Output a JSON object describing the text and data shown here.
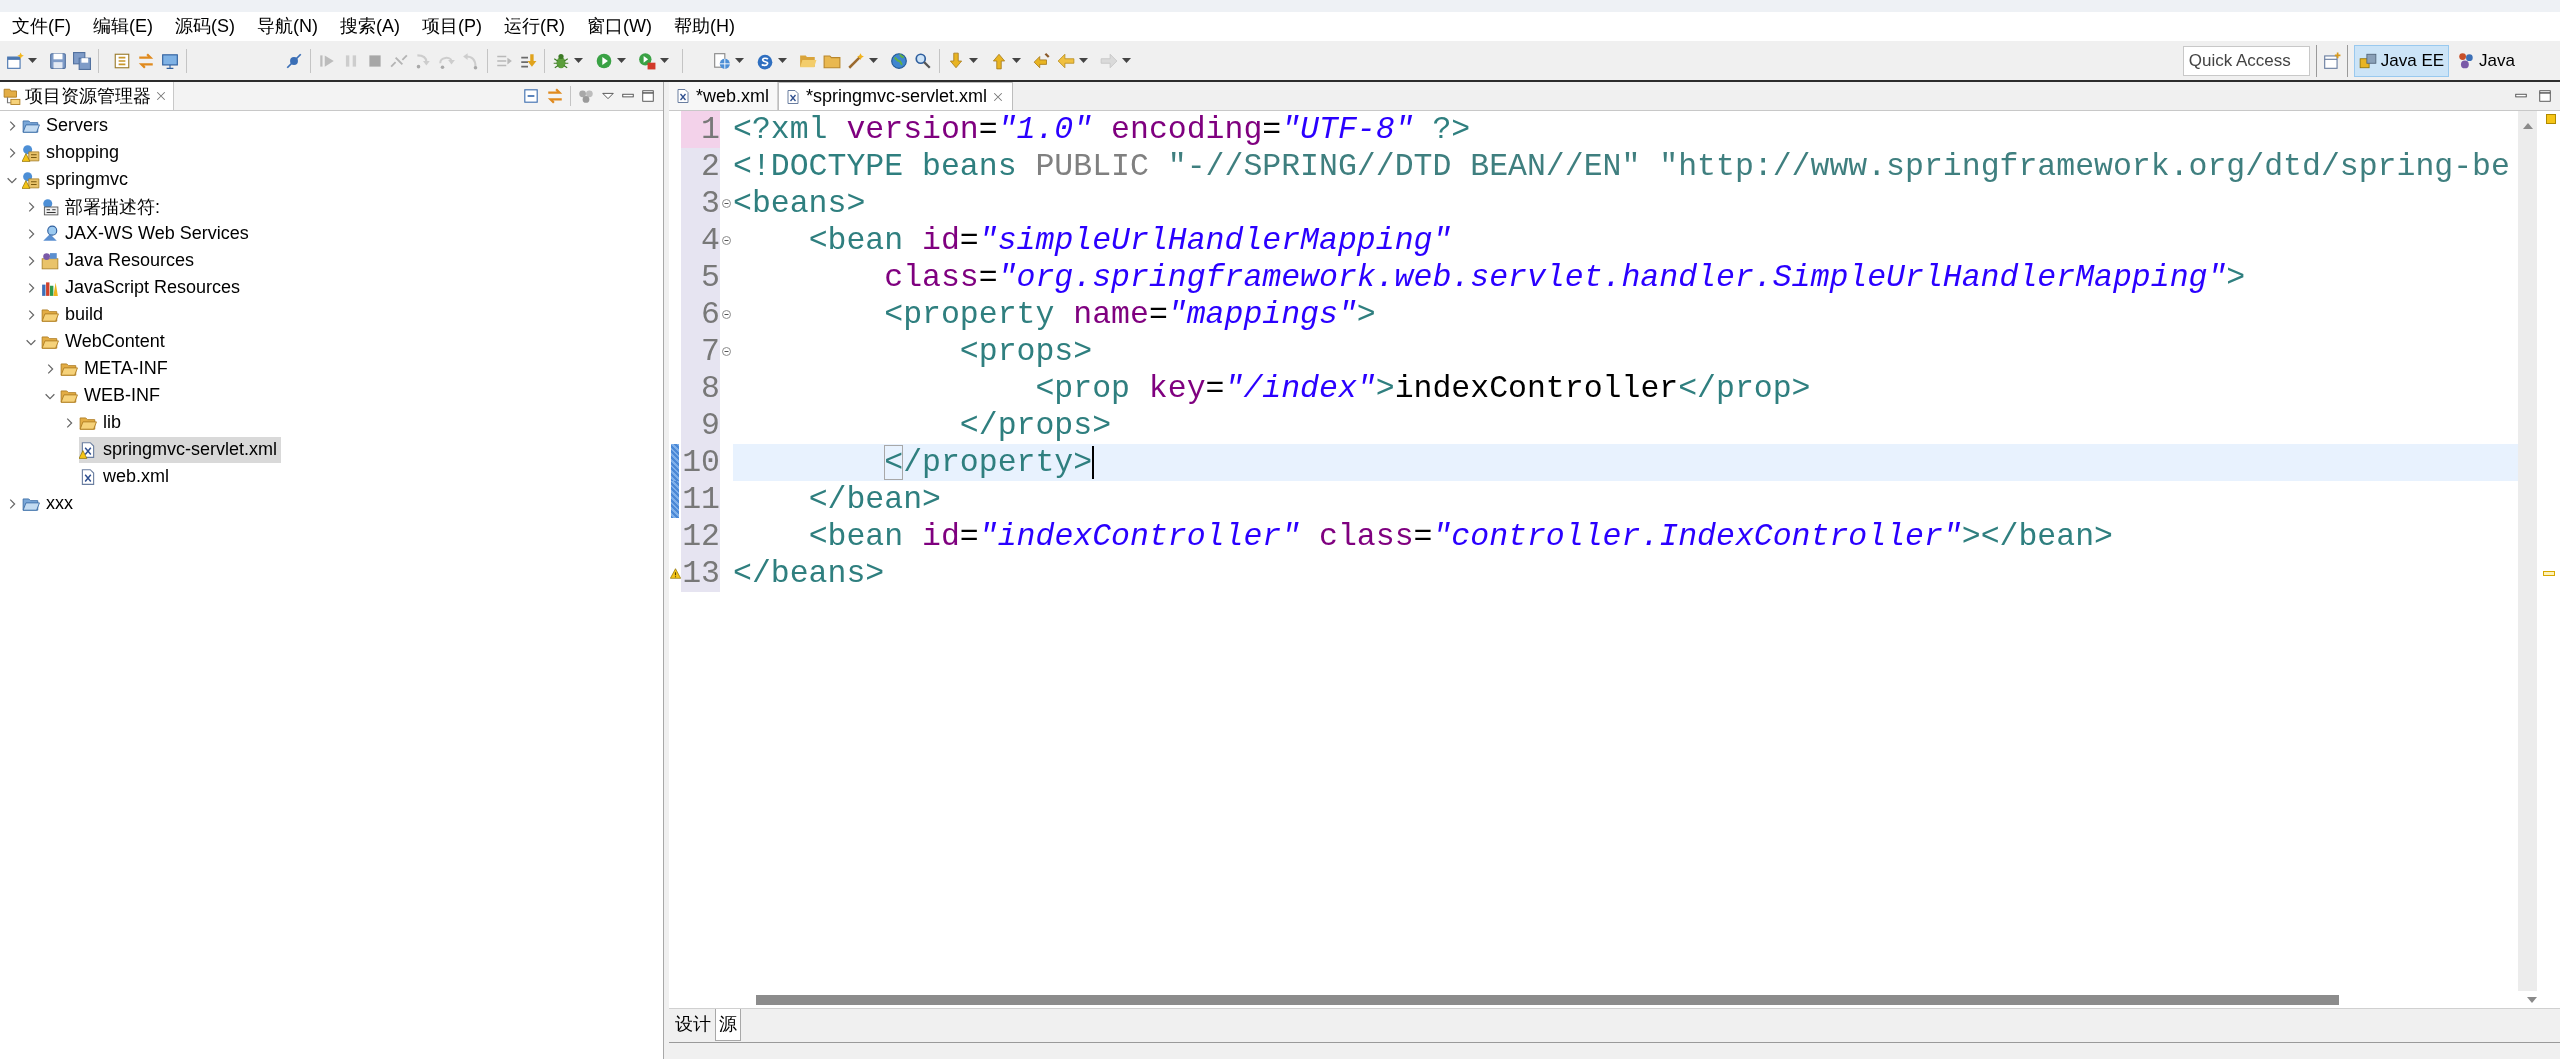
{
  "menu": [
    "文件(F)",
    "编辑(E)",
    "源码(S)",
    "导航(N)",
    "搜索(A)",
    "项目(P)",
    "运行(R)",
    "窗口(W)",
    "帮助(H)"
  ],
  "toolbar": [
    {
      "items": [
        {
          "kind": "new",
          "dropdown": true,
          "disabled": false
        },
        {
          "kind": "save",
          "dropdown": false,
          "disabled": false
        },
        {
          "kind": "save_all",
          "dropdown": false,
          "disabled": false
        }
      ]
    },
    {
      "items": [
        {
          "kind": "outline",
          "dropdown": false,
          "disabled": false
        },
        {
          "kind": "swap",
          "dropdown": false,
          "disabled": false
        },
        {
          "kind": "monitor",
          "dropdown": false,
          "disabled": false
        }
      ]
    },
    {
      "items": [
        {
          "kind": "skip_breakpoints",
          "dropdown": false,
          "disabled": false
        }
      ]
    },
    {
      "items": [
        {
          "kind": "resume",
          "dropdown": false,
          "disabled": true
        },
        {
          "kind": "suspend",
          "dropdown": false,
          "disabled": true
        },
        {
          "kind": "terminate",
          "dropdown": false,
          "disabled": true
        },
        {
          "kind": "disconnect",
          "dropdown": false,
          "disabled": true
        },
        {
          "kind": "step_into",
          "dropdown": false,
          "disabled": true
        },
        {
          "kind": "step_over",
          "dropdown": false,
          "disabled": true
        },
        {
          "kind": "step_return",
          "dropdown": false,
          "disabled": true
        }
      ]
    },
    {
      "items": [
        {
          "kind": "drop_frame",
          "dropdown": false,
          "disabled": true
        },
        {
          "kind": "step_filters",
          "dropdown": false,
          "disabled": false
        }
      ]
    },
    {
      "items": [
        {
          "kind": "debug",
          "dropdown": true,
          "disabled": false
        },
        {
          "kind": "run",
          "dropdown": true,
          "disabled": false
        },
        {
          "kind": "external",
          "dropdown": true,
          "disabled": false
        }
      ]
    },
    {
      "items": [
        {
          "kind": "new_server",
          "dropdown": true,
          "disabled": false
        },
        {
          "kind": "new_s",
          "dropdown": true,
          "disabled": false
        },
        {
          "kind": "open_folder",
          "dropdown": false,
          "disabled": false
        },
        {
          "kind": "folder",
          "dropdown": false,
          "disabled": false
        },
        {
          "kind": "wand",
          "dropdown": true,
          "disabled": false
        },
        {
          "kind": "globe",
          "dropdown": false,
          "disabled": false
        },
        {
          "kind": "magnifier",
          "dropdown": false,
          "disabled": false
        }
      ]
    },
    {
      "items": [
        {
          "kind": "next_annotation",
          "dropdown": true,
          "disabled": false
        },
        {
          "kind": "prev_annotation",
          "dropdown": true,
          "disabled": false
        },
        {
          "kind": "last_edit",
          "dropdown": false,
          "disabled": false
        },
        {
          "kind": "back",
          "dropdown": true,
          "disabled": false
        },
        {
          "kind": "forward",
          "dropdown": true,
          "disabled": true
        }
      ]
    }
  ],
  "quick_access": {
    "placeholder": "Quick Access"
  },
  "perspectives": [
    {
      "kind": "javaee",
      "label": "Java EE",
      "selected": true
    },
    {
      "kind": "java",
      "label": "Java",
      "selected": false
    }
  ],
  "explorer": {
    "title": "项目资源管理器",
    "tree": [
      {
        "label": "Servers",
        "kind": "server-folder",
        "expanded": false,
        "warning": false,
        "selected": false
      },
      {
        "label": "shopping",
        "kind": "project",
        "expanded": false,
        "warning": true,
        "selected": false
      },
      {
        "label": "springmvc",
        "kind": "project",
        "expanded": true,
        "warning": true,
        "selected": false,
        "children": [
          {
            "label": "部署描述符:",
            "kind": "descriptor",
            "expanded": false,
            "warning": false,
            "selected": false
          },
          {
            "label": "JAX-WS Web Services",
            "kind": "webservices",
            "expanded": false,
            "warning": false,
            "selected": false
          },
          {
            "label": "Java Resources",
            "kind": "java-resources",
            "expanded": false,
            "warning": false,
            "selected": false
          },
          {
            "label": "JavaScript Resources",
            "kind": "js-resources",
            "expanded": false,
            "warning": false,
            "selected": false
          },
          {
            "label": "build",
            "kind": "folder",
            "expanded": false,
            "warning": false,
            "selected": false
          },
          {
            "label": "WebContent",
            "kind": "folder",
            "expanded": true,
            "warning": false,
            "selected": false,
            "children": [
              {
                "label": "META-INF",
                "kind": "folder",
                "expanded": false,
                "warning": false,
                "selected": false
              },
              {
                "label": "WEB-INF",
                "kind": "folder",
                "expanded": true,
                "warning": false,
                "selected": false,
                "children": [
                  {
                    "label": "lib",
                    "kind": "folder",
                    "expanded": false,
                    "warning": false,
                    "selected": false
                  },
                  {
                    "label": "springmvc-servlet.xml",
                    "kind": "xml-file",
                    "warning": true,
                    "selected": true
                  },
                  {
                    "label": "web.xml",
                    "kind": "xml-file",
                    "warning": false,
                    "selected": false
                  }
                ]
              }
            ]
          }
        ]
      },
      {
        "label": "xxx",
        "kind": "server-folder",
        "expanded": false,
        "warning": false,
        "selected": false
      }
    ]
  },
  "editor": {
    "tabs": [
      {
        "label": "*web.xml",
        "selected": false
      },
      {
        "label": "*springmvc-servlet.xml",
        "selected": true
      }
    ],
    "lines": [
      {
        "number": "1",
        "marked": true,
        "current": false,
        "changed": false,
        "warning": false,
        "fold": false,
        "tokens": [
          {
            "kind": "tag",
            "text": "<?xml"
          },
          {
            "kind": "attr",
            "text": " version"
          },
          {
            "kind": "text",
            "text": "="
          },
          {
            "kind": "value",
            "text": "\"1.0\""
          },
          {
            "kind": "attr",
            "text": " encoding"
          },
          {
            "kind": "text",
            "text": "="
          },
          {
            "kind": "value",
            "text": "\"UTF-8\""
          },
          {
            "kind": "tag",
            "text": " ?>"
          }
        ]
      },
      {
        "number": "2",
        "marked": false,
        "current": false,
        "changed": false,
        "warning": false,
        "fold": false,
        "tokens": [
          {
            "kind": "tag",
            "text": "<!DOCTYPE"
          },
          {
            "kind": "tag",
            "text": " beans"
          },
          {
            "kind": "keyword",
            "text": " PUBLIC"
          },
          {
            "kind": "doctype-id",
            "text": " \"-//SPRING//DTD BEAN//EN\""
          },
          {
            "kind": "doctype-id",
            "text": " \"http://www.springframework.org/dtd/spring-be"
          }
        ]
      },
      {
        "number": "3",
        "marked": false,
        "current": false,
        "changed": false,
        "warning": false,
        "fold": true,
        "tokens": [
          {
            "kind": "tag",
            "text": "<beans>"
          }
        ]
      },
      {
        "number": "4",
        "marked": false,
        "current": false,
        "changed": false,
        "warning": false,
        "fold": true,
        "tokens": [
          {
            "kind": "tag",
            "text": "    <bean"
          },
          {
            "kind": "attr",
            "text": " id"
          },
          {
            "kind": "text",
            "text": "="
          },
          {
            "kind": "value",
            "text": "\"simpleUrlHandlerMapping\""
          }
        ]
      },
      {
        "number": "5",
        "marked": false,
        "current": false,
        "changed": false,
        "warning": false,
        "fold": false,
        "tokens": [
          {
            "kind": "attr",
            "text": "        class"
          },
          {
            "kind": "text",
            "text": "="
          },
          {
            "kind": "value",
            "text": "\"org.springframework.web.servlet.handler.SimpleUrlHandlerMapping\""
          },
          {
            "kind": "tag",
            "text": ">"
          }
        ]
      },
      {
        "number": "6",
        "marked": false,
        "current": false,
        "changed": false,
        "warning": false,
        "fold": true,
        "tokens": [
          {
            "kind": "tag",
            "text": "        <property"
          },
          {
            "kind": "attr",
            "text": " name"
          },
          {
            "kind": "text",
            "text": "="
          },
          {
            "kind": "value",
            "text": "\"mappings\""
          },
          {
            "kind": "tag",
            "text": ">"
          }
        ]
      },
      {
        "number": "7",
        "marked": false,
        "current": false,
        "changed": false,
        "warning": false,
        "fold": true,
        "tokens": [
          {
            "kind": "tag",
            "text": "            <props>"
          }
        ]
      },
      {
        "number": "8",
        "marked": false,
        "current": false,
        "changed": false,
        "warning": false,
        "fold": false,
        "tokens": [
          {
            "kind": "tag",
            "text": "                <prop"
          },
          {
            "kind": "attr",
            "text": " key"
          },
          {
            "kind": "text",
            "text": "="
          },
          {
            "kind": "value",
            "text": "\"/index\""
          },
          {
            "kind": "tag",
            "text": ">"
          },
          {
            "kind": "text",
            "text": "indexController"
          },
          {
            "kind": "tag",
            "text": "</prop>"
          }
        ]
      },
      {
        "number": "9",
        "marked": false,
        "current": false,
        "changed": false,
        "warning": false,
        "fold": false,
        "tokens": [
          {
            "kind": "tag",
            "text": "            </props>"
          }
        ]
      },
      {
        "number": "10",
        "marked": false,
        "current": true,
        "changed": true,
        "warning": false,
        "fold": false,
        "tokens": [
          {
            "kind": "match",
            "text": "        <"
          },
          {
            "kind": "tag",
            "text": "/property>"
          },
          {
            "kind": "caret"
          }
        ]
      },
      {
        "number": "11",
        "marked": false,
        "current": false,
        "changed": true,
        "warning": false,
        "fold": false,
        "tokens": [
          {
            "kind": "tag",
            "text": "    </bean>"
          }
        ]
      },
      {
        "number": "12",
        "marked": false,
        "current": false,
        "changed": false,
        "warning": false,
        "fold": false,
        "tokens": [
          {
            "kind": "tag",
            "text": "    <bean"
          },
          {
            "kind": "attr",
            "text": " id"
          },
          {
            "kind": "text",
            "text": "="
          },
          {
            "kind": "value",
            "text": "\"indexController\""
          },
          {
            "kind": "attr",
            "text": " class"
          },
          {
            "kind": "text",
            "text": "="
          },
          {
            "kind": "value",
            "text": "\"controller.IndexController\""
          },
          {
            "kind": "tag",
            "text": "></bean>"
          }
        ]
      },
      {
        "number": "13",
        "marked": false,
        "current": false,
        "changed": false,
        "warning": true,
        "fold": false,
        "tokens": [
          {
            "kind": "tag",
            "text": "</beans>"
          }
        ]
      }
    ],
    "mode_tabs": [
      {
        "label": "设计",
        "selected": false
      },
      {
        "label": "源",
        "selected": true
      }
    ]
  }
}
